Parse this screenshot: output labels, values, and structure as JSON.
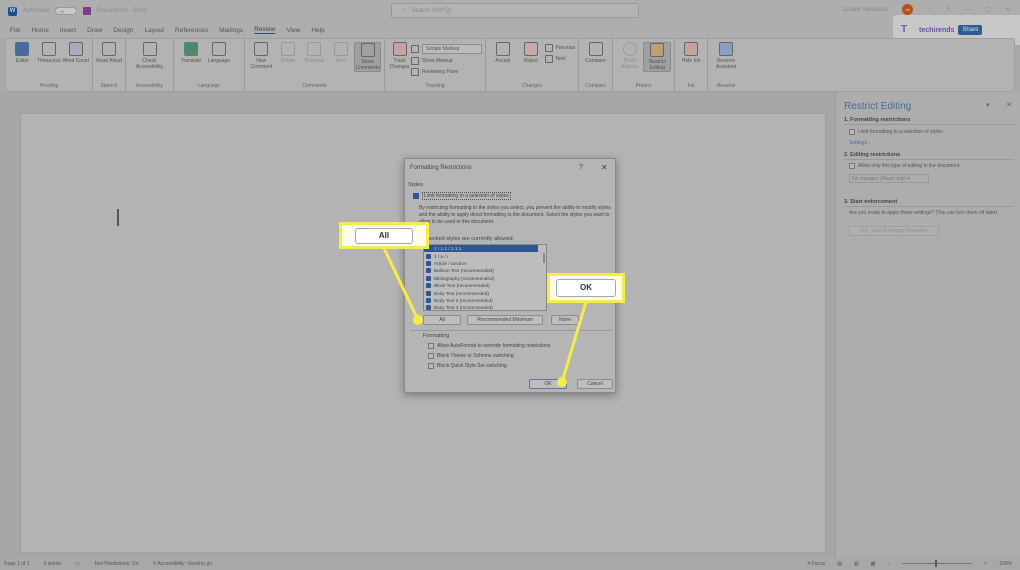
{
  "titlebar": {
    "autosave_label": "AutoSave",
    "autosave_state": "Off",
    "doc_title": "Document1 - Word",
    "search_placeholder": "Search (Alt+Q)",
    "user_name": "Joseph Mendoza",
    "user_initials": "JM"
  },
  "menu": [
    "File",
    "Home",
    "Insert",
    "Draw",
    "Design",
    "Layout",
    "References",
    "Mailings",
    "Review",
    "View",
    "Help"
  ],
  "menu_active": "Review",
  "watermark": {
    "brand": "techirends",
    "share_label": "Share"
  },
  "ribbon": {
    "groups": [
      {
        "label": "Proofing",
        "buttons": [
          "Editor",
          "Thesaurus",
          "Word Count"
        ]
      },
      {
        "label": "Speech",
        "buttons": [
          "Read Aloud"
        ]
      },
      {
        "label": "Accessibility",
        "buttons": [
          "Check Accessibility"
        ]
      },
      {
        "label": "Language",
        "buttons": [
          "Translate",
          "Language"
        ]
      },
      {
        "label": "Comments",
        "buttons": [
          "New Comment",
          "Delete",
          "Previous",
          "Next",
          "Show Comments"
        ]
      },
      {
        "label": "Tracking",
        "buttons": [
          "Track Changes"
        ],
        "small": [
          "Simple Markup",
          "Show Markup",
          "Reviewing Pane"
        ]
      },
      {
        "label": "Changes",
        "buttons": [
          "Accept",
          "Reject"
        ],
        "small": [
          "Previous",
          "Next"
        ]
      },
      {
        "label": "Compare",
        "buttons": [
          "Compare"
        ]
      },
      {
        "label": "Protect",
        "buttons": [
          "Block Authors",
          "Restrict Editing"
        ]
      },
      {
        "label": "Ink",
        "buttons": [
          "Hide Ink"
        ]
      },
      {
        "label": "Resume",
        "buttons": [
          "Resume Assistant"
        ]
      }
    ]
  },
  "pane": {
    "title": "Restrict Editing",
    "s1_heading": "1. Formatting restrictions",
    "s1_checkbox": "Limit formatting to a selection of styles",
    "s1_link": "Settings...",
    "s2_heading": "2. Editing restrictions",
    "s2_checkbox": "Allow only this type of editing in the document:",
    "s2_select": "No changes (Read only)",
    "s3_heading": "3. Start enforcement",
    "s3_text": "Are you ready to apply these settings? (You can turn them off later)",
    "s3_button": "Yes, Start Enforcing Protection"
  },
  "dialog": {
    "title": "Formatting Restrictions",
    "help": "?",
    "close": "✕",
    "styles_label": "Styles",
    "limit_checkbox": "Limit formatting to a selection of styles",
    "limit_checked": true,
    "description": "By restricting formatting to the styles you select, you prevent the ability to modify styles and the ability to apply direct formatting to the document. Select the styles you want to allow to be used in this document.",
    "list_label": "Checked styles are currently allowed:",
    "styles": [
      "1 / 1.1 / 1.1.1",
      "1 / a / i",
      "Article / Section",
      "Balloon Text (recommended)",
      "Bibliography (recommended)",
      "Block Text (recommended)",
      "Body Text (recommended)",
      "Body Text 2 (recommended)",
      "Body Text 3 (recommended)"
    ],
    "btn_all": "All",
    "btn_recommended": "Recommended Minimum",
    "btn_none": "None",
    "formatting_label": "Formatting",
    "fmt_options": [
      "Allow AutoFormat to override formatting restrictions",
      "Block Theme or Scheme switching",
      "Block Quick Style Set switching"
    ],
    "ok": "OK",
    "cancel": "Cancel"
  },
  "callouts": {
    "all": "All",
    "ok": "OK",
    "color": "#f5ec4a"
  },
  "status": {
    "page": "Page 1 of 1",
    "words": "0 words",
    "predictions": "Text Predictions: On",
    "accessibility": "Accessibility: Good to go",
    "focus": "Focus",
    "zoom": "100%"
  }
}
